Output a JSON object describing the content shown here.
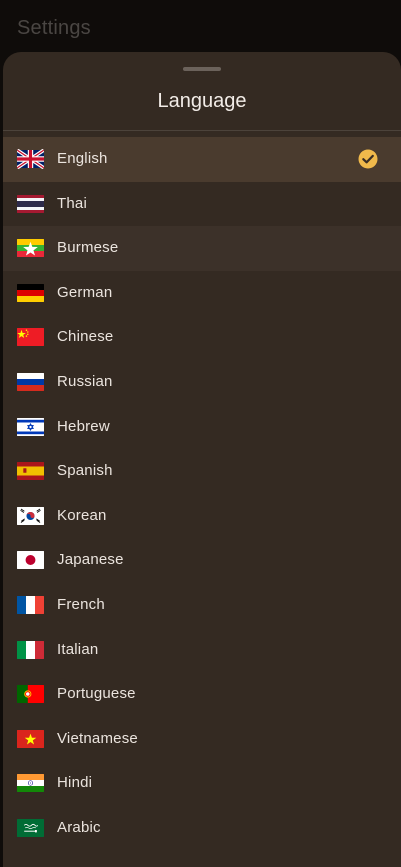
{
  "app_bar": {
    "title": "Settings"
  },
  "sheet": {
    "title": "Language",
    "selected_index": 0,
    "hovered_index": 2,
    "languages": [
      {
        "label": "English",
        "flag": "uk-flag-icon"
      },
      {
        "label": "Thai",
        "flag": "thailand-flag-icon"
      },
      {
        "label": "Burmese",
        "flag": "myanmar-flag-icon"
      },
      {
        "label": "German",
        "flag": "germany-flag-icon"
      },
      {
        "label": "Chinese",
        "flag": "china-flag-icon"
      },
      {
        "label": "Russian",
        "flag": "russia-flag-icon"
      },
      {
        "label": "Hebrew",
        "flag": "israel-flag-icon"
      },
      {
        "label": "Spanish",
        "flag": "spain-flag-icon"
      },
      {
        "label": "Korean",
        "flag": "south-korea-flag-icon"
      },
      {
        "label": "Japanese",
        "flag": "japan-flag-icon"
      },
      {
        "label": "French",
        "flag": "france-flag-icon"
      },
      {
        "label": "Italian",
        "flag": "italy-flag-icon"
      },
      {
        "label": "Portuguese",
        "flag": "portugal-flag-icon"
      },
      {
        "label": "Vietnamese",
        "flag": "vietnam-flag-icon"
      },
      {
        "label": "Hindi",
        "flag": "india-flag-icon"
      },
      {
        "label": "Arabic",
        "flag": "saudi-arabia-flag-icon"
      }
    ]
  },
  "colors": {
    "accent": "#f0b94b",
    "sheet_bg": "#342a22",
    "selected_row": "#4a3b2e"
  }
}
